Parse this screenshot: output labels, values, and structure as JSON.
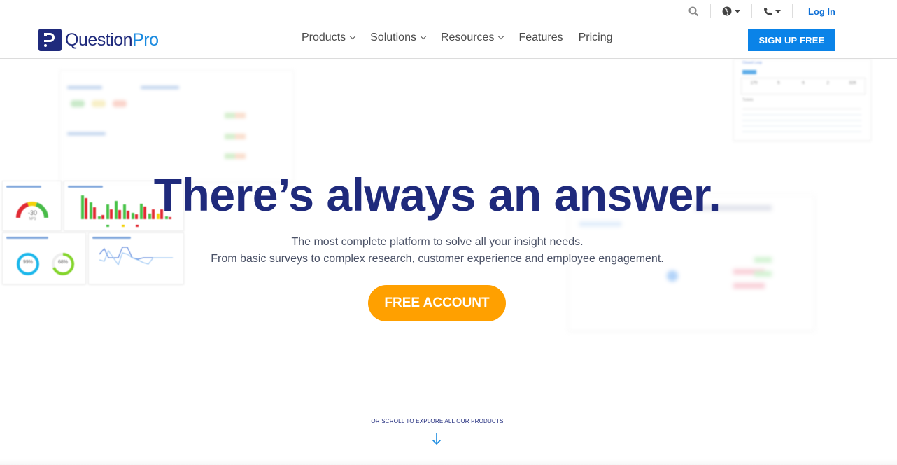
{
  "brand": {
    "name_part1": "Question",
    "name_part2": "Pro",
    "primary": "#1f2a7c",
    "accent": "#1b8be0"
  },
  "utility": {
    "search_icon": "search-icon",
    "globe_icon": "globe-icon",
    "phone_icon": "phone-icon",
    "login_label": "Log In"
  },
  "nav": {
    "items": [
      {
        "label": "Products",
        "has_dropdown": true
      },
      {
        "label": "Solutions",
        "has_dropdown": true
      },
      {
        "label": "Resources",
        "has_dropdown": true
      },
      {
        "label": "Features",
        "has_dropdown": false
      },
      {
        "label": "Pricing",
        "has_dropdown": false
      }
    ],
    "signup_label": "SIGN UP FREE"
  },
  "hero": {
    "title": "There’s always an answer.",
    "subtitle_line1": "The most complete platform to solve all your insight needs.",
    "subtitle_line2": "From basic surveys to complex research, customer experience and employee engagement.",
    "cta_label": "FREE ACCOUNT"
  },
  "dashboards": {
    "nps_gauge": {
      "value": "-30",
      "label": "NPS"
    },
    "completion_rate": "99%",
    "response_rate": "68%",
    "closed_loop": {
      "title": "Closed Loop",
      "stats": [
        "170",
        "5",
        "6",
        "2",
        "326"
      ],
      "tickets_label": "Tickets"
    }
  },
  "scroll": {
    "label": "OR SCROLL TO EXPLORE ALL OUR PRODUCTS"
  },
  "colors": {
    "cta": "#ffa000",
    "signup": "#0a83e8",
    "title": "#1f2a7c"
  }
}
